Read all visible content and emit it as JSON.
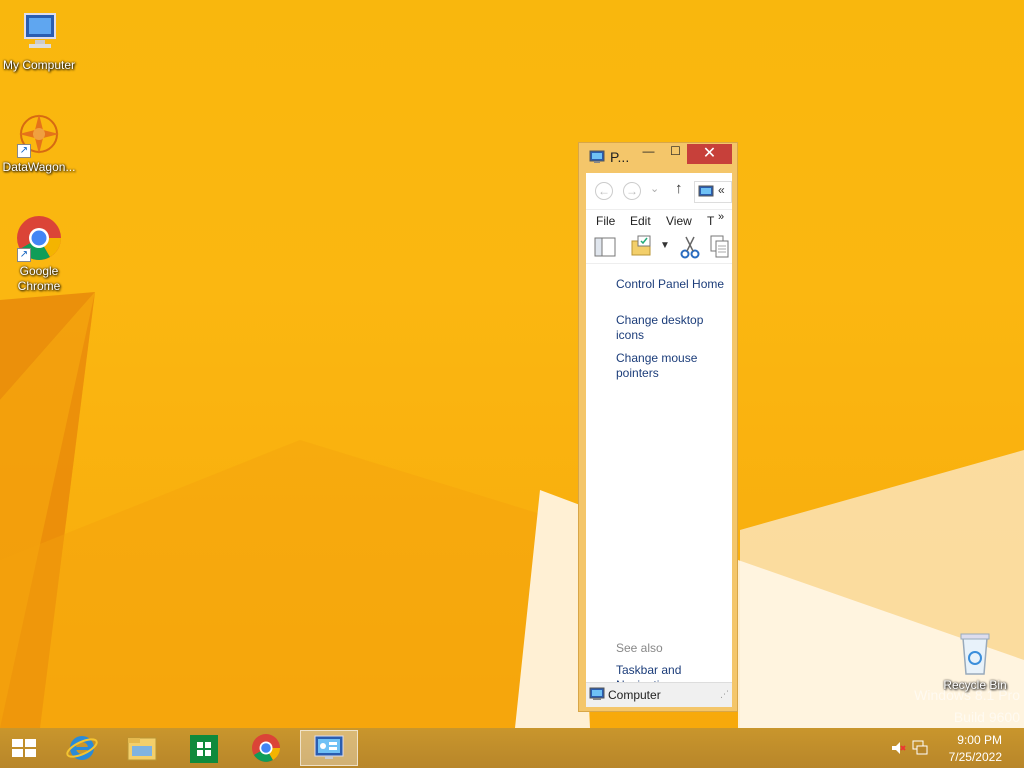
{
  "desktop": {
    "icons": [
      {
        "label": "My Computer",
        "icon": "computer-icon"
      },
      {
        "label": "DataWagon...",
        "icon": "datawagon-icon"
      },
      {
        "label": "Google Chrome",
        "icon": "chrome-icon"
      },
      {
        "label": "Recycle Bin",
        "icon": "recycle-bin-icon"
      }
    ],
    "watermark": {
      "line1": "Windows 8.1 Pro",
      "line2": "Build 9600"
    }
  },
  "window": {
    "title": "P...",
    "controls": {
      "minimize": "—",
      "maximize": "☐",
      "close": "✕"
    },
    "nav": {
      "back": "←",
      "forward": "→",
      "dropdown": "⌄",
      "up": "↑",
      "overflow": "«"
    },
    "menu": [
      "File",
      "Edit",
      "View",
      "T"
    ],
    "menu_overflow": "»",
    "links": {
      "home": "Control Panel Home",
      "desktop_icons": "Change desktop icons",
      "mouse_pointers": "Change mouse pointers"
    },
    "see_also": {
      "heading": "See also",
      "taskbar": "Taskbar and Navigation"
    },
    "status": "Computer"
  },
  "taskbar": {
    "apps": [
      {
        "icon": "start-icon"
      },
      {
        "icon": "internet-explorer-icon"
      },
      {
        "icon": "file-explorer-icon"
      },
      {
        "icon": "store-icon"
      },
      {
        "icon": "chrome-icon"
      },
      {
        "icon": "control-panel-icon",
        "active": true
      }
    ],
    "time": "9:00 PM",
    "date": "7/25/2022"
  },
  "colors": {
    "accent": "#fbb711",
    "close": "#c7403a",
    "link": "#1c3d7a",
    "taskbar": "#c9962c"
  }
}
